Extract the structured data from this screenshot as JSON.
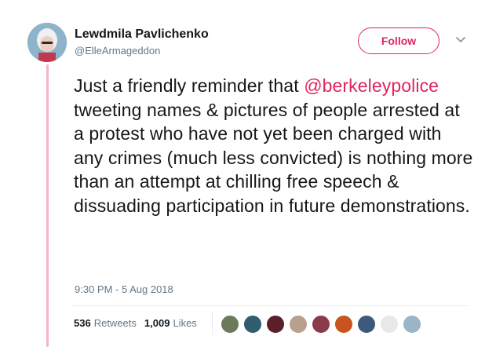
{
  "user": {
    "display_name": "Lewdmila Pavlichenko",
    "handle": "@ElleArmageddon"
  },
  "follow_label": "Follow",
  "tweet": {
    "text_before": "Just a friendly reminder that ",
    "mention": "@berkeleypolice",
    "text_after": " tweeting names & pictures of people arrested at a protest who have not yet been charged with any crimes (much less convicted) is nothing more than an attempt at chilling free speech & dissuading participation in future demonstrations.",
    "timestamp": "9:30 PM - 5 Aug 2018"
  },
  "stats": {
    "retweets_count": "536",
    "retweets_label": "Retweets",
    "likes_count": "1,009",
    "likes_label": "Likes"
  },
  "colors": {
    "accent": "#e0245e",
    "thread_line": "#f5b4c9",
    "muted_text": "#657786"
  },
  "likers": [
    {
      "color": "#6b7b5a"
    },
    {
      "color": "#2f5d6e"
    },
    {
      "color": "#5a1f2a"
    },
    {
      "color": "#b8a08c"
    },
    {
      "color": "#8a3b4a"
    },
    {
      "color": "#c9541f"
    },
    {
      "color": "#3d5a7a"
    },
    {
      "color": "#e8e8e8"
    },
    {
      "color": "#9bb5c8"
    }
  ]
}
